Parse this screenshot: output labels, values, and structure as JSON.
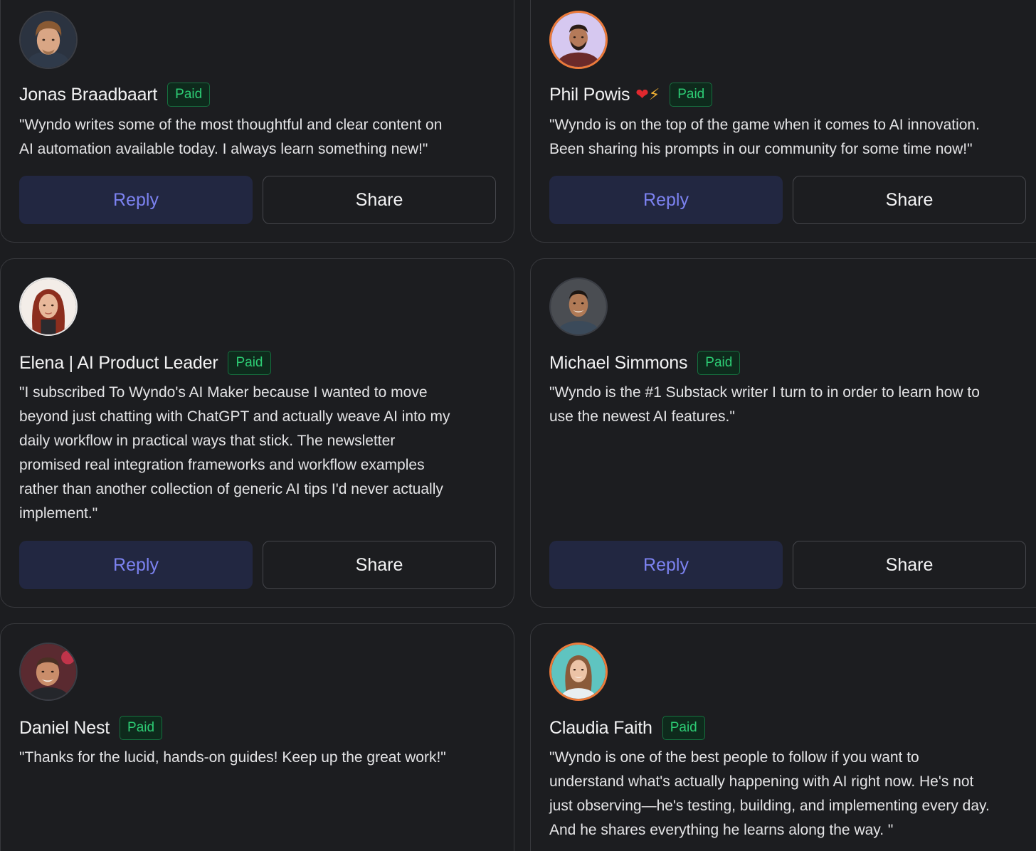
{
  "badge_label": "Paid",
  "buttons": {
    "reply": "Reply",
    "share": "Share"
  },
  "colors": {
    "background": "#1c1d20",
    "card_border": "#38393d",
    "badge_text": "#2dcc74",
    "badge_bg": "#0e2a1c",
    "reply_bg": "#222741",
    "reply_text": "#7c82f0"
  },
  "testimonials": [
    {
      "name": "Jonas Braadbaart",
      "badge": "Paid",
      "quote": "\"Wyndo writes some of the most thoughtful and clear content on\nAI automation available today. I always learn something new!\""
    },
    {
      "name": "Phil Powis",
      "name_emoji": "❤️⚡",
      "badge": "Paid",
      "quote": "\"Wyndo is on the top of the game when it comes to AI innovation.\nBeen sharing his prompts in our community for some time now!\""
    },
    {
      "name": "Elena | AI Product Leader",
      "badge": "Paid",
      "quote": "\"I subscribed To Wyndo's AI Maker because I wanted to move\nbeyond just chatting with ChatGPT and actually weave AI into my\ndaily workflow in practical ways that stick. The newsletter\npromised real integration frameworks and workflow examples\nrather than another collection of generic AI tips I'd never actually\nimplement.\""
    },
    {
      "name": "Michael Simmons",
      "badge": "Paid",
      "quote": "\"Wyndo is the #1 Substack writer I turn to in order to learn how to\nuse the newest AI features.\""
    },
    {
      "name": "Daniel Nest",
      "badge": "Paid",
      "quote": "\"Thanks for the lucid, hands-on guides! Keep up the great work!\""
    },
    {
      "name": "Claudia Faith",
      "badge": "Paid",
      "quote": "\"Wyndo is one of the best people to follow if you want to\nunderstand what's actually happening with AI right now. He's not\njust observing—he's testing, building, and implementing every day.\nAnd he shares everything he learns along the way. \""
    }
  ]
}
